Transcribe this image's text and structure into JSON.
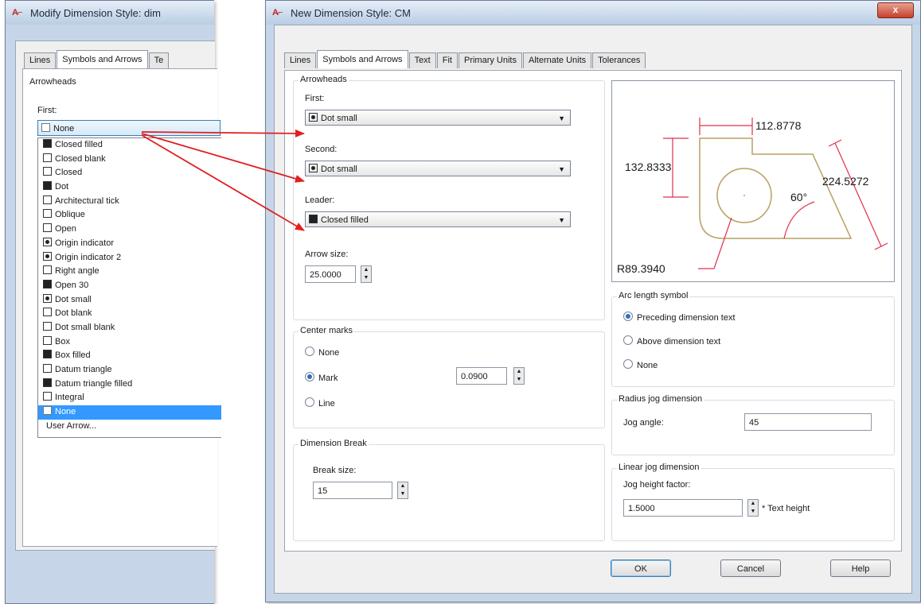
{
  "left_dialog": {
    "title": "Modify Dimension Style: dim",
    "tabs": [
      "Lines",
      "Symbols and Arrows",
      "Te"
    ],
    "arrowheads_label": "Arrowheads",
    "first_label": "First:",
    "first_value": "None",
    "list_items": [
      "Closed filled",
      "Closed blank",
      "Closed",
      "Dot",
      "Architectural tick",
      "Oblique",
      "Open",
      "Origin indicator",
      "Origin indicator 2",
      "Right angle",
      "Open 30",
      "Dot small",
      "Dot blank",
      "Dot small blank",
      "Box",
      "Box filled",
      "Datum triangle",
      "Datum triangle filled",
      "Integral",
      "None",
      "User Arrow..."
    ]
  },
  "main_dialog": {
    "title": "New Dimension Style: CM",
    "close_label": "x",
    "tabs": [
      "Lines",
      "Symbols and Arrows",
      "Text",
      "Fit",
      "Primary Units",
      "Alternate Units",
      "Tolerances"
    ],
    "arrowheads": {
      "group_label": "Arrowheads",
      "first_label": "First:",
      "first_value": "Dot small",
      "second_label": "Second:",
      "second_value": "Dot small",
      "leader_label": "Leader:",
      "leader_value": "Closed filled",
      "arrow_size_label": "Arrow size:",
      "arrow_size_value": "25.0000"
    },
    "center_marks": {
      "group_label": "Center marks",
      "options": [
        "None",
        "Mark",
        "Line"
      ],
      "selected": "Mark",
      "value": "0.0900"
    },
    "dimension_break": {
      "group_label": "Dimension Break",
      "break_size_label": "Break size:",
      "break_size_value": "15"
    },
    "preview": {
      "dim_top": "112.8778",
      "dim_left": "132.8333",
      "dim_right": "224.5272",
      "angle": "60°",
      "radius": "R89.3940"
    },
    "arc_length_symbol": {
      "group_label": "Arc length symbol",
      "options": [
        "Preceding dimension text",
        "Above dimension text",
        "None"
      ],
      "selected": "Preceding dimension text"
    },
    "radius_jog": {
      "group_label": "Radius jog dimension",
      "jog_angle_label": "Jog angle:",
      "jog_angle_value": "45"
    },
    "linear_jog": {
      "group_label": "Linear jog dimension",
      "jog_height_label": "Jog height factor:",
      "jog_height_value": "1.5000",
      "suffix": "* Text height"
    },
    "buttons": {
      "ok": "OK",
      "cancel": "Cancel",
      "help": "Help"
    }
  },
  "colors": {
    "arrow": "#e02020",
    "drawing": "#b8a060",
    "dimension": "#e0304a",
    "selection": "#3399ff"
  }
}
